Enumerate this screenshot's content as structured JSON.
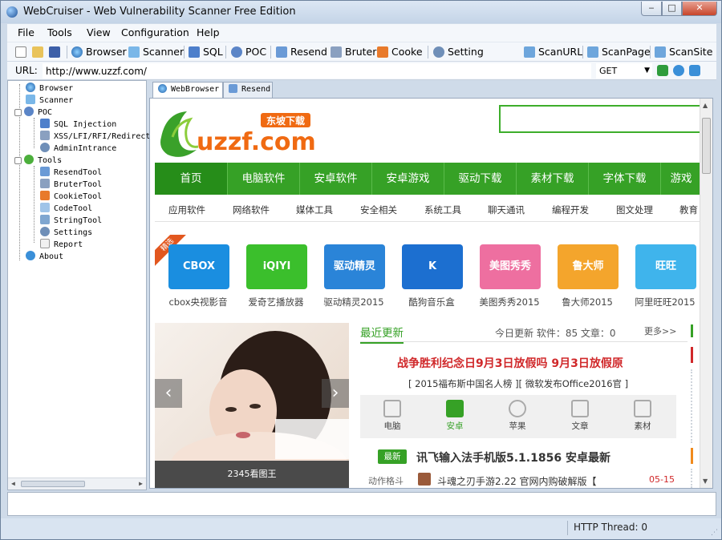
{
  "window": {
    "title": "WebCruiser - Web Vulnerability Scanner Free Edition",
    "min": "‒",
    "max": "□",
    "close": "✕"
  },
  "menu": [
    "File",
    "Tools",
    "View",
    "Configuration",
    "Help"
  ],
  "toolbar": {
    "browser": "Browser",
    "scanner": "Scanner",
    "sql": "SQL",
    "poc": "POC",
    "resend": "Resend",
    "bruter": "Bruter",
    "cooke": "Cooke",
    "setting": "Setting",
    "scan_url": "ScanURL",
    "scan_page": "ScanPage",
    "scan_site": "ScanSite"
  },
  "urlbar": {
    "label": "URL:",
    "value": "http://www.uzzf.com/",
    "method": "GET"
  },
  "tree": {
    "browser": "Browser",
    "scanner": "Scanner",
    "poc": "POC",
    "sql_injection": "SQL Injection",
    "xss": "XSS/LFI/RFI/Redirect",
    "admin": "AdminIntrance",
    "tools": "Tools",
    "resend_tool": "ResendTool",
    "bruter_tool": "BruterTool",
    "cookie_tool": "CookieTool",
    "code_tool": "CodeTool",
    "string_tool": "StringTool",
    "settings": "Settings",
    "report": "Report",
    "about": "About"
  },
  "tabs": {
    "web_browser": "WebBrowser",
    "resend": "Resend"
  },
  "site": {
    "logo_text": "uzzf.com",
    "logo_tag": "东坡下载",
    "nav": [
      "首页",
      "电脑软件",
      "安卓软件",
      "安卓游戏",
      "驱动下载",
      "素材下载",
      "字体下载",
      "游戏"
    ],
    "subnav": [
      "应用软件",
      "网络软件",
      "媒体工具",
      "安全相关",
      "系统工具",
      "聊天通讯",
      "编程开发",
      "图文处理",
      "教育"
    ],
    "featured_badge": "精选",
    "apps": [
      {
        "name": "cbox央视影音",
        "icon": "CBOX",
        "color": "#1a8ee0"
      },
      {
        "name": "爱奇艺播放器",
        "icon": "iQIYI",
        "color": "#3bbf2c"
      },
      {
        "name": "驱动精灵2015",
        "icon": "驱动精灵",
        "color": "#2a84d8"
      },
      {
        "name": "酷狗音乐盒",
        "icon": "K",
        "color": "#1c6fd0"
      },
      {
        "name": "美图秀秀2015",
        "icon": "美图秀秀",
        "color": "#ee6fa0"
      },
      {
        "name": "鲁大师2015",
        "icon": "鲁大师",
        "color": "#f4a52c"
      },
      {
        "name": "阿里旺旺2015",
        "icon": "旺旺",
        "color": "#3fb4ec"
      }
    ],
    "banner_caption": "2345看图王",
    "news_title": "最近更新",
    "news_stats": "今日更新 软件：85 文章：0",
    "more": "更多>>",
    "headline": "战争胜利纪念日9月3日放假吗 9月3日放假原",
    "sublinks": "[ 2015福布斯中国名人榜 ][ 微软发布Office2016官 ]",
    "categories": [
      "电脑",
      "安卓",
      "苹果",
      "文章",
      "素材"
    ],
    "new_badge": "最新",
    "new_text": "讯飞输入法手机版5.1.1856 安卓最新",
    "row_cat": "动作格斗",
    "row_text": "斗魂之刃手游2.22 官网内购破解版【",
    "row_date": "05-15"
  },
  "status": {
    "http_thread": "HTTP Thread: 0"
  },
  "colors": {
    "accent_green": "#36a126",
    "headline_red": "#d0282a"
  }
}
